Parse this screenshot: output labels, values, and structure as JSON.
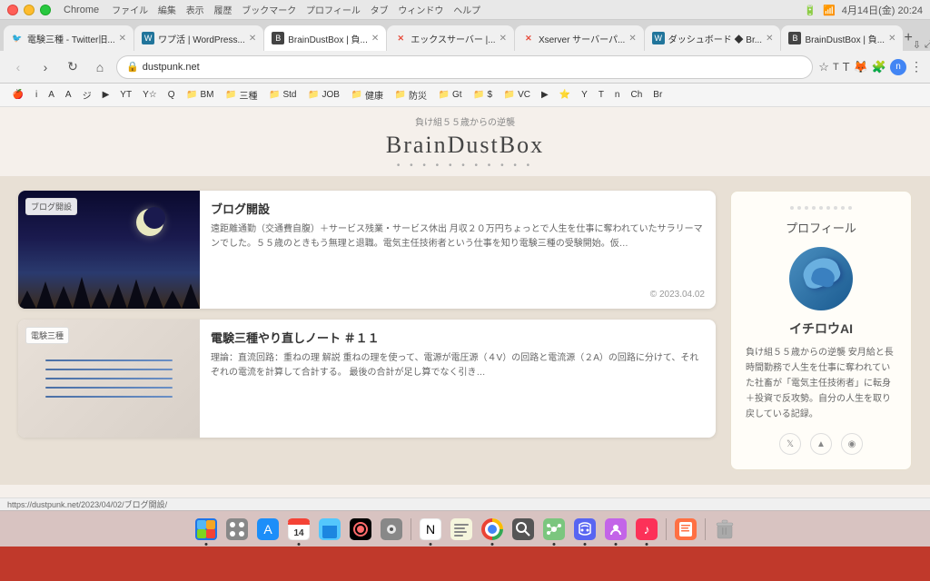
{
  "titlebar": {
    "app": "Chrome",
    "menu": [
      "ファイル",
      "編集",
      "表示",
      "履歴",
      "ブックマーク",
      "プロフィール",
      "タブ",
      "ウィンドウ",
      "ヘルプ"
    ],
    "datetime": "4月14日(金)  20:24",
    "battery": "●",
    "wifi": "●"
  },
  "tabs": [
    {
      "label": "電験三種 - Twitter旧...",
      "favicon": "🐦",
      "active": false
    },
    {
      "label": "ワプ活 | WordPress...",
      "favicon": "W",
      "active": false
    },
    {
      "label": "BrainDustBox | 負...",
      "favicon": "B",
      "active": true
    },
    {
      "label": "エックスサーバー |...",
      "favicon": "✕",
      "active": false
    },
    {
      "label": "Xserver サーバーパ...",
      "favicon": "✕",
      "active": false
    },
    {
      "label": "ダッシュボード ◆ Br...",
      "favicon": "W",
      "active": false
    },
    {
      "label": "BrainDustBox | 負...",
      "favicon": "B",
      "active": false
    }
  ],
  "address_bar": {
    "url": "dustpunk.net",
    "lock_icon": "🔒"
  },
  "bookmarks": [
    {
      "label": "i",
      "icon": "🍎"
    },
    {
      "label": "A",
      "icon": ""
    },
    {
      "label": "A",
      "icon": ""
    },
    {
      "label": "ジ",
      "icon": ""
    },
    {
      "label": "▶",
      "icon": ""
    },
    {
      "label": "YT",
      "icon": ""
    },
    {
      "label": "Y☆ Q",
      "icon": ""
    },
    {
      "label": "BM",
      "icon": "📁"
    },
    {
      "label": "三種",
      "icon": "📁"
    },
    {
      "label": "Std",
      "icon": "📁"
    },
    {
      "label": "JOB",
      "icon": "📁"
    },
    {
      "label": "健康",
      "icon": "📁"
    },
    {
      "label": "防災",
      "icon": "📁"
    },
    {
      "label": "Gt",
      "icon": "📁"
    },
    {
      "label": "$",
      "icon": "📁"
    },
    {
      "label": "VC",
      "icon": "📁"
    },
    {
      "label": "▶",
      "icon": ""
    },
    {
      "label": "★",
      "icon": "⭐"
    },
    {
      "label": "Y",
      "icon": ""
    },
    {
      "label": "T",
      "icon": ""
    },
    {
      "label": "n",
      "icon": ""
    },
    {
      "label": "Ch",
      "icon": ""
    },
    {
      "label": "Br",
      "icon": ""
    }
  ],
  "site": {
    "tagline": "負け組５５歳からの逆襲",
    "title": "BrainDustBox",
    "dots": "• • • • • • • • • • •"
  },
  "articles": [
    {
      "badge": "ブログ開設",
      "title": "ブログ開設",
      "excerpt": "遠距離通勤（交通費自腹）＋サービス残業・サービス休出 月収２０万円ちょっとで人生を仕事に奪われていたサラリーマンでした。５５歳のときもう無理と退職。電気主任技術者という仕事を知り電験三種の受験開始。仮…",
      "date": "© 2023.04.02",
      "img_type": "night"
    },
    {
      "badge": "電験三種",
      "title": "電験三種やり直しノート ＃１１",
      "excerpt": "理論：直流回路：重ねの理 解説 重ねの理を使って、電源が電圧源（４V）の回路と電流源（２A）の回路に分けて、それぞれの電流を計算して合計する。 最後の合計が足し算でなく引き…",
      "date": "",
      "img_type": "notebook"
    }
  ],
  "sidebar": {
    "profile_dots": [
      "•",
      "•",
      "•",
      "•",
      "•",
      "•",
      "•",
      "•",
      "•"
    ],
    "section_title": "プロフィール",
    "name": "イチロウAI",
    "bio": "負け組５５歳からの逆襲\n安月給と長時間勤務で人生を仕事に奪われていた社畜が「電気主任技術者」に転身＋投資で反攻勢。自分の人生を取り戻している記録。",
    "social_icons": [
      "🐦",
      "⬆",
      "🔗"
    ]
  },
  "status_bar": {
    "url": "https://dustpunk.net/2023/04/02/ブログ開設/"
  },
  "dock": {
    "items": [
      "🍎",
      "🟦",
      "🅰",
      "📅",
      "📁",
      "🌄",
      "⚙",
      "📓",
      "📄",
      "🌐",
      "🔍",
      "🗂",
      "💬",
      "🎮",
      "🎵",
      "✏"
    ]
  }
}
